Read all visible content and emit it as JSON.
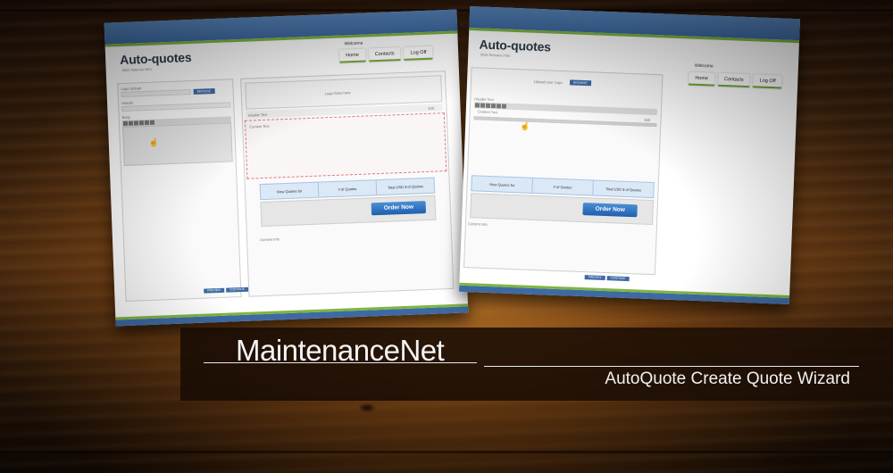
{
  "colors": {
    "header_blue": "#3e6aa3",
    "accent_green": "#7fb542",
    "order_button": "#1f5fae",
    "banner_bg": "#190c04"
  },
  "screens": {
    "left": {
      "logo": "Auto-quotes",
      "logo_subtitle": "Main features intro",
      "welcome": "Welcome",
      "nav": [
        "Home",
        "Contacts",
        "Log Off"
      ],
      "sidebar": {
        "field1_label": "Logo Upload",
        "browse_label": "BROWSE",
        "field2_label": "Header",
        "field3_label": "Body",
        "toolbar_icons": [
          "bold-icon",
          "italic-icon",
          "underline-icon",
          "image-icon",
          "list-icon",
          "align-icon"
        ]
      },
      "logo_placeholder": "Logo Goes here",
      "header_text": "Header Text",
      "header_edit": "Edit",
      "content_text": "Content Text",
      "table_headers": [
        "View Quotes for",
        "# of Quotes",
        "Total USD $ of Quotes"
      ],
      "order_button": "Order Now",
      "content_lower": "Content Info",
      "footer_buttons": [
        "PREVIEW",
        "CONTINUE"
      ]
    },
    "right": {
      "logo": "Auto-quotes",
      "logo_subtitle": "Main features intro",
      "welcome": "Welcome",
      "nav": [
        "Home",
        "Contacts",
        "Log Off"
      ],
      "upload_label": "Upload your Logo",
      "browse_label": "BROWSE",
      "header_text": "Header Text",
      "header_edit": "Edit",
      "content_text": "Content Text",
      "table_headers": [
        "View Quotes for",
        "# of Quotes",
        "Total USD $ of Quotes"
      ],
      "order_button": "Order Now",
      "content_lower": "Content Info",
      "footer_buttons": [
        "PREVIEW",
        "CONTINUE"
      ]
    }
  },
  "banner": {
    "title": "MaintenanceNet",
    "subtitle": "AutoQuote Create Quote Wizard"
  }
}
